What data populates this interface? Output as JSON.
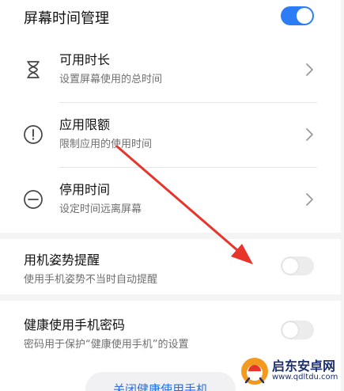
{
  "screen_time": {
    "title": "屏幕时间管理",
    "enabled": true
  },
  "items": [
    {
      "title": "可用时长",
      "subtitle": "设置屏幕使用的总时间",
      "icon": "hourglass-icon"
    },
    {
      "title": "应用限额",
      "subtitle": "限制应用的使用时间",
      "icon": "alert-circle-icon"
    },
    {
      "title": "停用时间",
      "subtitle": "设定时间远离屏幕",
      "icon": "minus-circle-icon"
    }
  ],
  "posture": {
    "title": "用机姿势提醒",
    "subtitle": "使用手机姿势不当时自动提醒",
    "enabled": false
  },
  "password": {
    "title": "健康使用手机密码",
    "subtitle": "密码用于保护“健康使用手机”的设置",
    "enabled": false
  },
  "close_button": "关闭健康使用手机",
  "watermark": {
    "name": "启东安卓网",
    "url": "www.qdltdu.com"
  },
  "colors": {
    "accent": "#2c7cf6",
    "arrow": "#e8352c"
  }
}
